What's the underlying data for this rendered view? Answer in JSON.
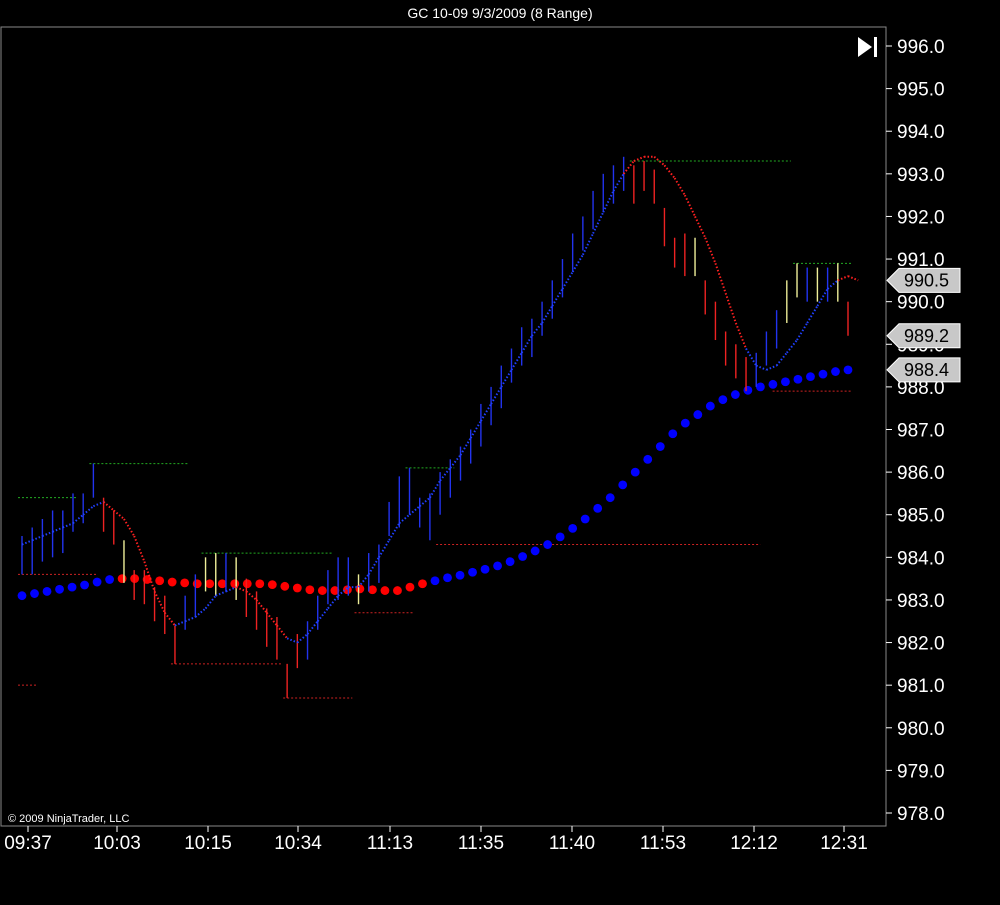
{
  "window": {
    "title": "GC 10-09  9/3/2009 (8 Range)",
    "copyright": "© 2009 NinjaTrader, LLC",
    "scroll_icon": "scroll-to-end-icon"
  },
  "colors": {
    "background": "#000000",
    "up_bar": "#2233ee",
    "down_bar": "#ee2222",
    "neutral_bar": "#eeee99",
    "fast_ma_up": "#2040ff",
    "fast_ma_down": "#ff2020",
    "slow_ma_up": "#0000ff",
    "slow_ma_down": "#ff0000",
    "resistance_line": "#22aa22",
    "support_line": "#cc2222",
    "badge_fill": "#c8c8c8"
  },
  "chart_data": {
    "type": "line",
    "x_tick_labels": [
      "09:37",
      "10:03",
      "10:15",
      "10:34",
      "11:13",
      "11:35",
      "11:40",
      "11:53",
      "12:12",
      "12:31"
    ],
    "y_tick_labels": [
      "978.0",
      "979.0",
      "980.0",
      "981.0",
      "982.0",
      "983.0",
      "984.0",
      "985.0",
      "986.0",
      "987.0",
      "988.0",
      "989.0",
      "990.0",
      "991.0",
      "992.0",
      "993.0",
      "994.0",
      "995.0",
      "996.0"
    ],
    "ylim": [
      977.6,
      996.6
    ],
    "grid": false,
    "price_badges": [
      {
        "label": "990.5",
        "value": 990.5
      },
      {
        "label": "989.2",
        "value": 989.2
      },
      {
        "label": "988.4",
        "value": 988.4
      }
    ],
    "bars": [
      {
        "high": 984.5,
        "low": 983.6,
        "dir": "up"
      },
      {
        "high": 984.7,
        "low": 983.6,
        "dir": "up"
      },
      {
        "high": 984.9,
        "low": 983.9,
        "dir": "up"
      },
      {
        "high": 985.1,
        "low": 984.0,
        "dir": "up"
      },
      {
        "high": 985.1,
        "low": 984.1,
        "dir": "up"
      },
      {
        "high": 985.5,
        "low": 984.6,
        "dir": "up"
      },
      {
        "high": 985.5,
        "low": 984.8,
        "dir": "up"
      },
      {
        "high": 986.2,
        "low": 985.4,
        "dir": "up"
      },
      {
        "high": 985.4,
        "low": 984.6,
        "dir": "down"
      },
      {
        "high": 985.1,
        "low": 984.3,
        "dir": "down"
      },
      {
        "high": 984.4,
        "low": 983.4,
        "dir": "neutral"
      },
      {
        "high": 983.7,
        "low": 983.0,
        "dir": "down"
      },
      {
        "high": 983.7,
        "low": 982.9,
        "dir": "down"
      },
      {
        "high": 983.3,
        "low": 982.5,
        "dir": "down"
      },
      {
        "high": 983.1,
        "low": 982.2,
        "dir": "down"
      },
      {
        "high": 982.4,
        "low": 981.5,
        "dir": "down"
      },
      {
        "high": 983.1,
        "low": 982.3,
        "dir": "up"
      },
      {
        "high": 983.6,
        "low": 982.6,
        "dir": "up"
      },
      {
        "high": 984.0,
        "low": 983.2,
        "dir": "neutral"
      },
      {
        "high": 984.1,
        "low": 983.1,
        "dir": "neutral"
      },
      {
        "high": 984.1,
        "low": 983.2,
        "dir": "up"
      },
      {
        "high": 984.0,
        "low": 983.0,
        "dir": "neutral"
      },
      {
        "high": 983.5,
        "low": 982.6,
        "dir": "down"
      },
      {
        "high": 983.2,
        "low": 982.3,
        "dir": "down"
      },
      {
        "high": 982.8,
        "low": 981.9,
        "dir": "down"
      },
      {
        "high": 982.6,
        "low": 981.6,
        "dir": "down"
      },
      {
        "high": 981.5,
        "low": 980.7,
        "dir": "down"
      },
      {
        "high": 982.2,
        "low": 981.4,
        "dir": "down"
      },
      {
        "high": 982.5,
        "low": 981.6,
        "dir": "up"
      },
      {
        "high": 983.1,
        "low": 982.3,
        "dir": "up"
      },
      {
        "high": 983.7,
        "low": 982.9,
        "dir": "up"
      },
      {
        "high": 984.0,
        "low": 983.0,
        "dir": "up"
      },
      {
        "high": 984.0,
        "low": 983.1,
        "dir": "up"
      },
      {
        "high": 983.6,
        "low": 982.9,
        "dir": "neutral"
      },
      {
        "high": 984.1,
        "low": 983.2,
        "dir": "up"
      },
      {
        "high": 984.3,
        "low": 983.4,
        "dir": "up"
      },
      {
        "high": 985.3,
        "low": 984.5,
        "dir": "up"
      },
      {
        "high": 985.9,
        "low": 984.7,
        "dir": "up"
      },
      {
        "high": 986.1,
        "low": 985.0,
        "dir": "up"
      },
      {
        "high": 985.4,
        "low": 984.7,
        "dir": "up"
      },
      {
        "high": 985.5,
        "low": 984.4,
        "dir": "up"
      },
      {
        "high": 986.0,
        "low": 985.0,
        "dir": "up"
      },
      {
        "high": 986.3,
        "low": 985.4,
        "dir": "up"
      },
      {
        "high": 986.6,
        "low": 985.8,
        "dir": "up"
      },
      {
        "high": 987.0,
        "low": 986.2,
        "dir": "up"
      },
      {
        "high": 987.6,
        "low": 986.6,
        "dir": "up"
      },
      {
        "high": 988.0,
        "low": 987.1,
        "dir": "up"
      },
      {
        "high": 988.5,
        "low": 987.5,
        "dir": "up"
      },
      {
        "high": 988.9,
        "low": 988.1,
        "dir": "up"
      },
      {
        "high": 989.4,
        "low": 988.5,
        "dir": "up"
      },
      {
        "high": 989.6,
        "low": 988.7,
        "dir": "up"
      },
      {
        "high": 990.0,
        "low": 989.2,
        "dir": "up"
      },
      {
        "high": 990.5,
        "low": 989.6,
        "dir": "up"
      },
      {
        "high": 991.0,
        "low": 990.1,
        "dir": "up"
      },
      {
        "high": 991.6,
        "low": 990.7,
        "dir": "up"
      },
      {
        "high": 992.0,
        "low": 991.2,
        "dir": "up"
      },
      {
        "high": 992.6,
        "low": 991.7,
        "dir": "up"
      },
      {
        "high": 993.0,
        "low": 992.1,
        "dir": "up"
      },
      {
        "high": 993.2,
        "low": 992.3,
        "dir": "up"
      },
      {
        "high": 993.4,
        "low": 992.6,
        "dir": "up"
      },
      {
        "high": 993.2,
        "low": 992.3,
        "dir": "down"
      },
      {
        "high": 993.3,
        "low": 992.6,
        "dir": "down"
      },
      {
        "high": 993.1,
        "low": 992.3,
        "dir": "down"
      },
      {
        "high": 992.2,
        "low": 991.3,
        "dir": "down"
      },
      {
        "high": 991.5,
        "low": 990.8,
        "dir": "down"
      },
      {
        "high": 991.6,
        "low": 990.6,
        "dir": "down"
      },
      {
        "high": 991.5,
        "low": 990.6,
        "dir": "neutral"
      },
      {
        "high": 990.5,
        "low": 989.7,
        "dir": "down"
      },
      {
        "high": 990.0,
        "low": 989.1,
        "dir": "down"
      },
      {
        "high": 989.3,
        "low": 988.5,
        "dir": "down"
      },
      {
        "high": 989.0,
        "low": 988.2,
        "dir": "down"
      },
      {
        "high": 988.7,
        "low": 987.9,
        "dir": "down"
      },
      {
        "high": 988.8,
        "low": 988.0,
        "dir": "up"
      },
      {
        "high": 989.3,
        "low": 988.5,
        "dir": "up"
      },
      {
        "high": 989.8,
        "low": 988.9,
        "dir": "up"
      },
      {
        "high": 990.5,
        "low": 989.5,
        "dir": "neutral"
      },
      {
        "high": 990.9,
        "low": 990.1,
        "dir": "neutral"
      },
      {
        "high": 990.8,
        "low": 990.0,
        "dir": "up"
      },
      {
        "high": 990.8,
        "low": 990.0,
        "dir": "neutral"
      },
      {
        "high": 990.8,
        "low": 990.0,
        "dir": "up"
      },
      {
        "high": 990.9,
        "low": 990.0,
        "dir": "neutral"
      },
      {
        "high": 990.0,
        "low": 989.2,
        "dir": "down"
      }
    ],
    "fast_ma": [
      984.3,
      984.4,
      984.5,
      984.6,
      984.7,
      984.8,
      985.0,
      985.2,
      985.3,
      985.1,
      984.9,
      984.5,
      983.9,
      983.2,
      982.7,
      982.4,
      982.5,
      982.6,
      982.8,
      983.1,
      983.2,
      983.3,
      983.2,
      983.0,
      982.7,
      982.4,
      982.1,
      982.0,
      982.2,
      982.5,
      982.8,
      983.1,
      983.3,
      983.3,
      983.6,
      984.0,
      984.4,
      984.8,
      985.0,
      985.2,
      985.4,
      985.8,
      986.1,
      986.4,
      986.8,
      987.2,
      987.6,
      988.0,
      988.4,
      988.8,
      989.2,
      989.5,
      989.9,
      990.3,
      990.7,
      991.1,
      991.6,
      992.1,
      992.6,
      993.0,
      993.3,
      993.4,
      993.4,
      993.2,
      992.9,
      992.5,
      992.0,
      991.5,
      990.9,
      990.2,
      989.5,
      988.9,
      988.5,
      988.4,
      988.5,
      988.8,
      989.1,
      989.5,
      989.9,
      990.3,
      990.5,
      990.6,
      990.5
    ],
    "fast_ma_color_flags": [
      "up",
      "up",
      "up",
      "up",
      "up",
      "up",
      "up",
      "up",
      "down",
      "down",
      "down",
      "down",
      "down",
      "down",
      "down",
      "up",
      "up",
      "up",
      "up",
      "up",
      "up",
      "down",
      "down",
      "down",
      "down",
      "down",
      "up",
      "up",
      "up",
      "up",
      "up",
      "up",
      "up",
      "up",
      "up",
      "up",
      "up",
      "up",
      "up",
      "up",
      "up",
      "up",
      "up",
      "up",
      "up",
      "up",
      "up",
      "up",
      "up",
      "up",
      "up",
      "up",
      "up",
      "up",
      "up",
      "up",
      "up",
      "up",
      "up",
      "down",
      "down",
      "down",
      "down",
      "down",
      "down",
      "down",
      "down",
      "down",
      "down",
      "down",
      "down",
      "up",
      "up",
      "up",
      "up",
      "up",
      "up",
      "up",
      "up",
      "up",
      "down",
      "down"
    ],
    "slow_ma": [
      983.1,
      983.15,
      983.2,
      983.25,
      983.3,
      983.35,
      983.42,
      983.48,
      983.5,
      983.5,
      983.48,
      983.45,
      983.42,
      983.4,
      983.38,
      983.38,
      983.38,
      983.38,
      983.38,
      983.38,
      983.36,
      983.32,
      983.28,
      983.24,
      983.22,
      983.22,
      983.24,
      983.26,
      983.24,
      983.22,
      983.22,
      983.3,
      983.38,
      983.45,
      983.52,
      983.58,
      983.65,
      983.72,
      983.8,
      983.9,
      984.02,
      984.15,
      984.3,
      984.48,
      984.68,
      984.9,
      985.15,
      985.4,
      985.7,
      986.0,
      986.3,
      986.6,
      986.9,
      987.15,
      987.35,
      987.55,
      987.7,
      987.82,
      987.92,
      988.0,
      988.06,
      988.12,
      988.18,
      988.24,
      988.3,
      988.36,
      988.4
    ],
    "slow_ma_red_range": [
      8,
      32
    ],
    "resistance_lines": [
      {
        "value": 985.4,
        "from_bar": 0,
        "to_bar": 5
      },
      {
        "value": 986.2,
        "from_bar": 7,
        "to_bar": 16
      },
      {
        "value": 984.1,
        "from_bar": 18,
        "to_bar": 30
      },
      {
        "value": 986.1,
        "from_bar": 38,
        "to_bar": 42
      },
      {
        "value": 993.3,
        "from_bar": 60,
        "to_bar": 75
      },
      {
        "value": 990.9,
        "from_bar": 76,
        "to_bar": 81
      }
    ],
    "support_lines": [
      {
        "value": 983.6,
        "from_bar": 0,
        "to_bar": 7
      },
      {
        "value": 981.0,
        "from_bar": 0,
        "to_bar": 1
      },
      {
        "value": 981.5,
        "from_bar": 15,
        "to_bar": 25
      },
      {
        "value": 980.7,
        "from_bar": 26,
        "to_bar": 32
      },
      {
        "value": 982.7,
        "from_bar": 33,
        "to_bar": 38
      },
      {
        "value": 984.3,
        "from_bar": 41,
        "to_bar": 72
      },
      {
        "value": 987.9,
        "from_bar": 74,
        "to_bar": 81
      }
    ]
  }
}
